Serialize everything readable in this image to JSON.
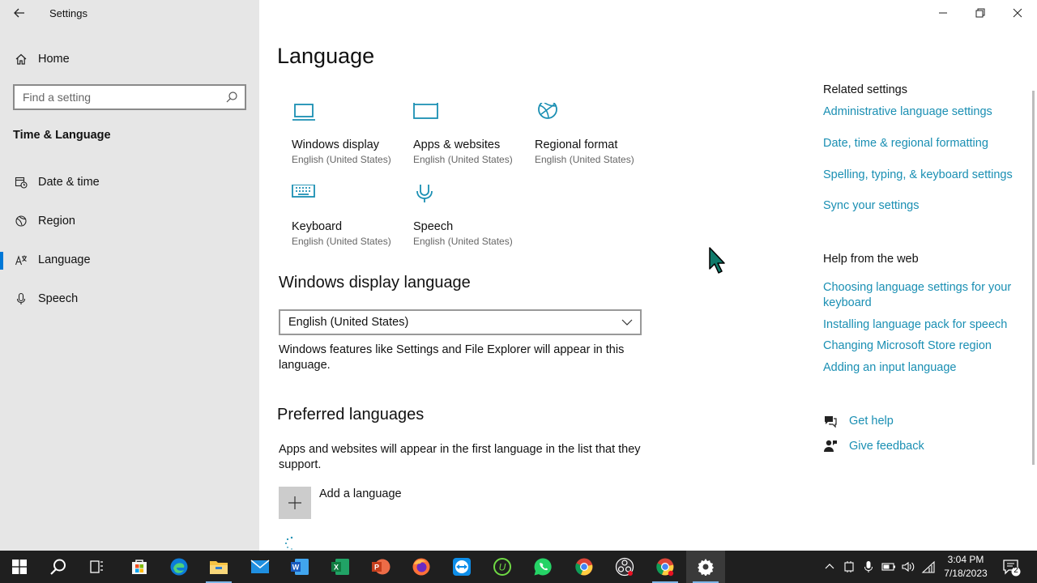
{
  "window": {
    "title": "Settings"
  },
  "sidebar": {
    "home_label": "Home",
    "search_placeholder": "Find a setting",
    "section_title": "Time & Language",
    "items": [
      {
        "label": "Date & time",
        "icon": "calendar-clock-icon"
      },
      {
        "label": "Region",
        "icon": "globe-icon"
      },
      {
        "label": "Language",
        "icon": "language-icon",
        "active": true
      },
      {
        "label": "Speech",
        "icon": "microphone-icon"
      }
    ]
  },
  "main": {
    "title": "Language",
    "tiles": [
      {
        "name": "Windows display",
        "sub": "English (United States)",
        "icon": "laptop-icon"
      },
      {
        "name": "Apps & websites",
        "sub": "English (United States)",
        "icon": "window-icon"
      },
      {
        "name": "Regional format",
        "sub": "English (United States)",
        "icon": "regional-globe-icon"
      },
      {
        "name": "Keyboard",
        "sub": "English (United States)",
        "icon": "keyboard-icon"
      },
      {
        "name": "Speech",
        "sub": "English (United States)",
        "icon": "microphone-icon"
      }
    ],
    "display_language": {
      "heading": "Windows display language",
      "selected": "English (United States)",
      "description": "Windows features like Settings and File Explorer will appear in this language."
    },
    "preferred": {
      "heading": "Preferred languages",
      "description": "Apps and websites will appear in the first language in the list that they support.",
      "add_label": "Add a language"
    }
  },
  "related": {
    "heading": "Related settings",
    "links": [
      "Administrative language settings",
      "Date, time & regional formatting",
      "Spelling, typing, & keyboard settings",
      "Sync your settings"
    ]
  },
  "help": {
    "heading": "Help from the web",
    "links": [
      "Choosing language settings for your keyboard",
      "Installing language pack for speech",
      "Changing Microsoft Store region",
      "Adding an input language"
    ],
    "get_help": "Get help",
    "give_feedback": "Give feedback"
  },
  "taskbar": {
    "time": "3:04 PM",
    "date": "7/18/2023",
    "notification_count": "2",
    "apps": [
      "start-icon",
      "search-icon",
      "task-view-icon",
      "store-icon",
      "edge-icon",
      "file-explorer-icon",
      "mail-icon",
      "word-icon",
      "excel-icon",
      "powerpoint-icon",
      "firefox-icon",
      "teamviewer-icon",
      "upwork-icon",
      "whatsapp-icon",
      "chrome-icon",
      "obs-icon",
      "chrome-icon",
      "settings-icon"
    ]
  },
  "colors": {
    "accent": "#0078d7",
    "link": "#1a8fb3",
    "sidebar_bg": "#e6e6e6",
    "taskbar_bg": "#1f1f1f"
  }
}
